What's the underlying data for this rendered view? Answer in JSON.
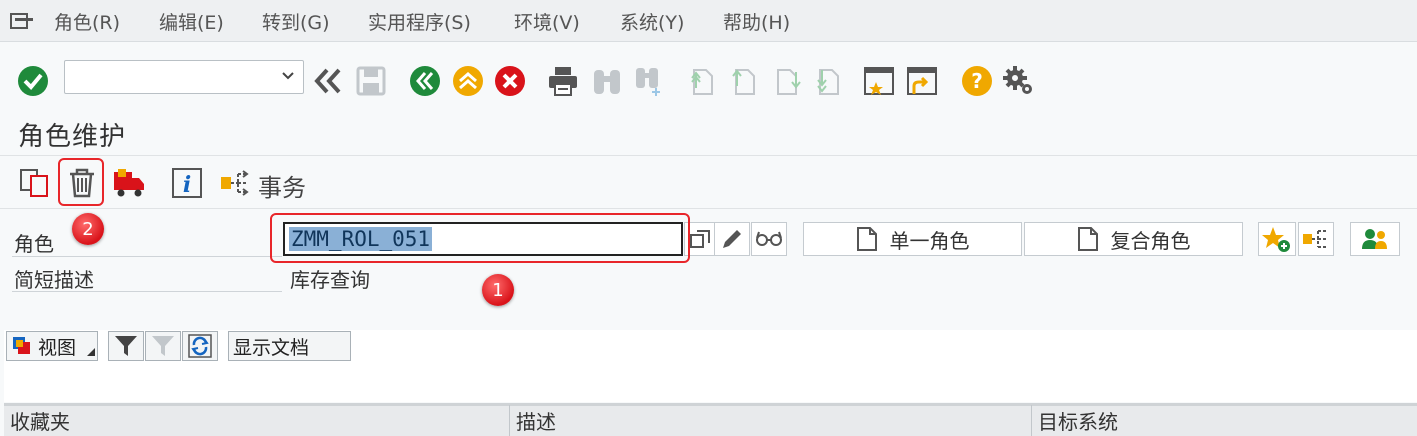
{
  "menu": {
    "items": [
      "角色(R)",
      "编辑(E)",
      "转到(G)",
      "实用程序(S)",
      "环境(V)",
      "系统(Y)",
      "帮助(H)"
    ]
  },
  "toolbar": {
    "command_field_value": ""
  },
  "page": {
    "title": "角色维护"
  },
  "app_toolbar": {
    "transaction_label": "事务"
  },
  "form": {
    "role_label": "角色",
    "role_value": "ZMM_ROL_051",
    "short_desc_label": "简短描述",
    "short_desc_value": "库存查询",
    "single_role_button": "单一角色",
    "composite_role_button": "复合角色"
  },
  "annotations": {
    "badge_1": "1",
    "badge_2": "2"
  },
  "lower_toolbar": {
    "view_button": "视图",
    "show_docs_button": "显示文档"
  },
  "table": {
    "columns": [
      "收藏夹",
      "描述",
      "目标系统"
    ]
  },
  "colors": {
    "accent_green": "#1f8a3b",
    "accent_yellow": "#f0a800",
    "accent_red": "#d9131a",
    "annotation_red": "#e8262a"
  }
}
